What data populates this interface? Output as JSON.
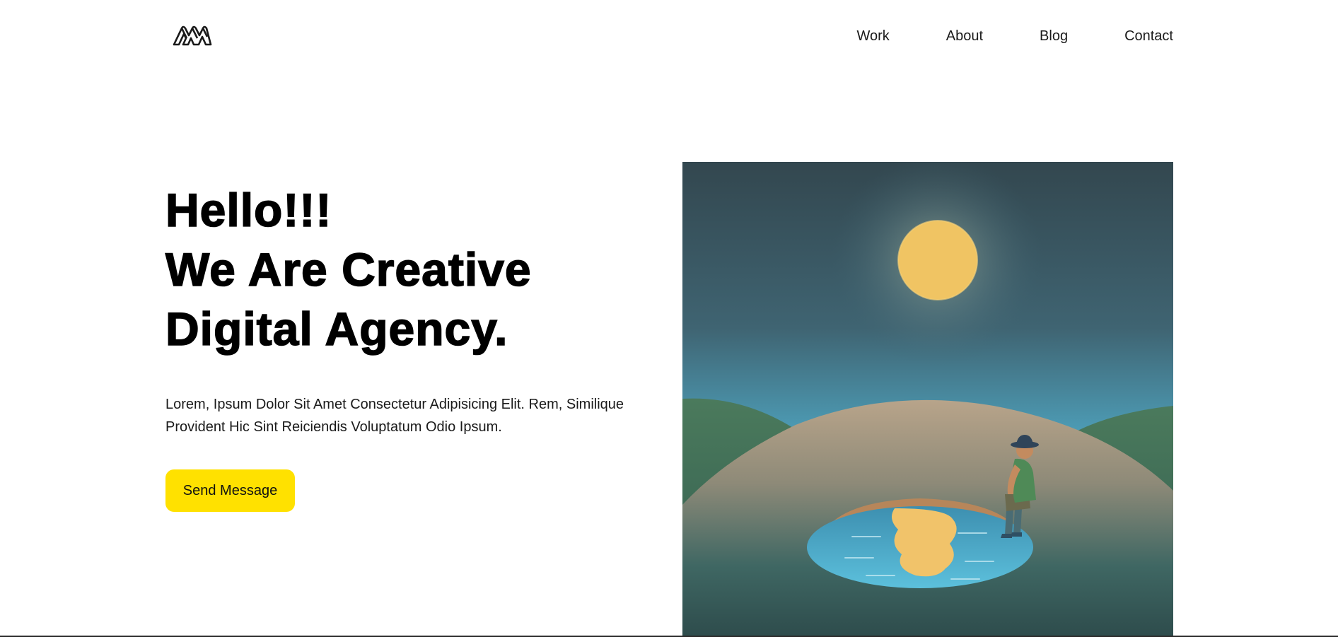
{
  "header": {
    "logo_icon": "agency-m-logo-icon",
    "nav": [
      {
        "label": "Work"
      },
      {
        "label": "About"
      },
      {
        "label": "Blog"
      },
      {
        "label": "Contact"
      }
    ]
  },
  "hero": {
    "title_lines": [
      "Hello!!!",
      "We Are Creative",
      "Digital Agency."
    ],
    "description": "Lorem, Ipsum Dolor Sit Amet Consectetur Adipisicing Elit. Rem, Similique Provident Hic Sint Reiciendis Voluptatum Odio Ipsum.",
    "cta_label": "Send Message",
    "illustration": "moon-pond-illustration"
  },
  "colors": {
    "accent": "#ffe100",
    "text": "#111111",
    "background": "#ffffff"
  }
}
